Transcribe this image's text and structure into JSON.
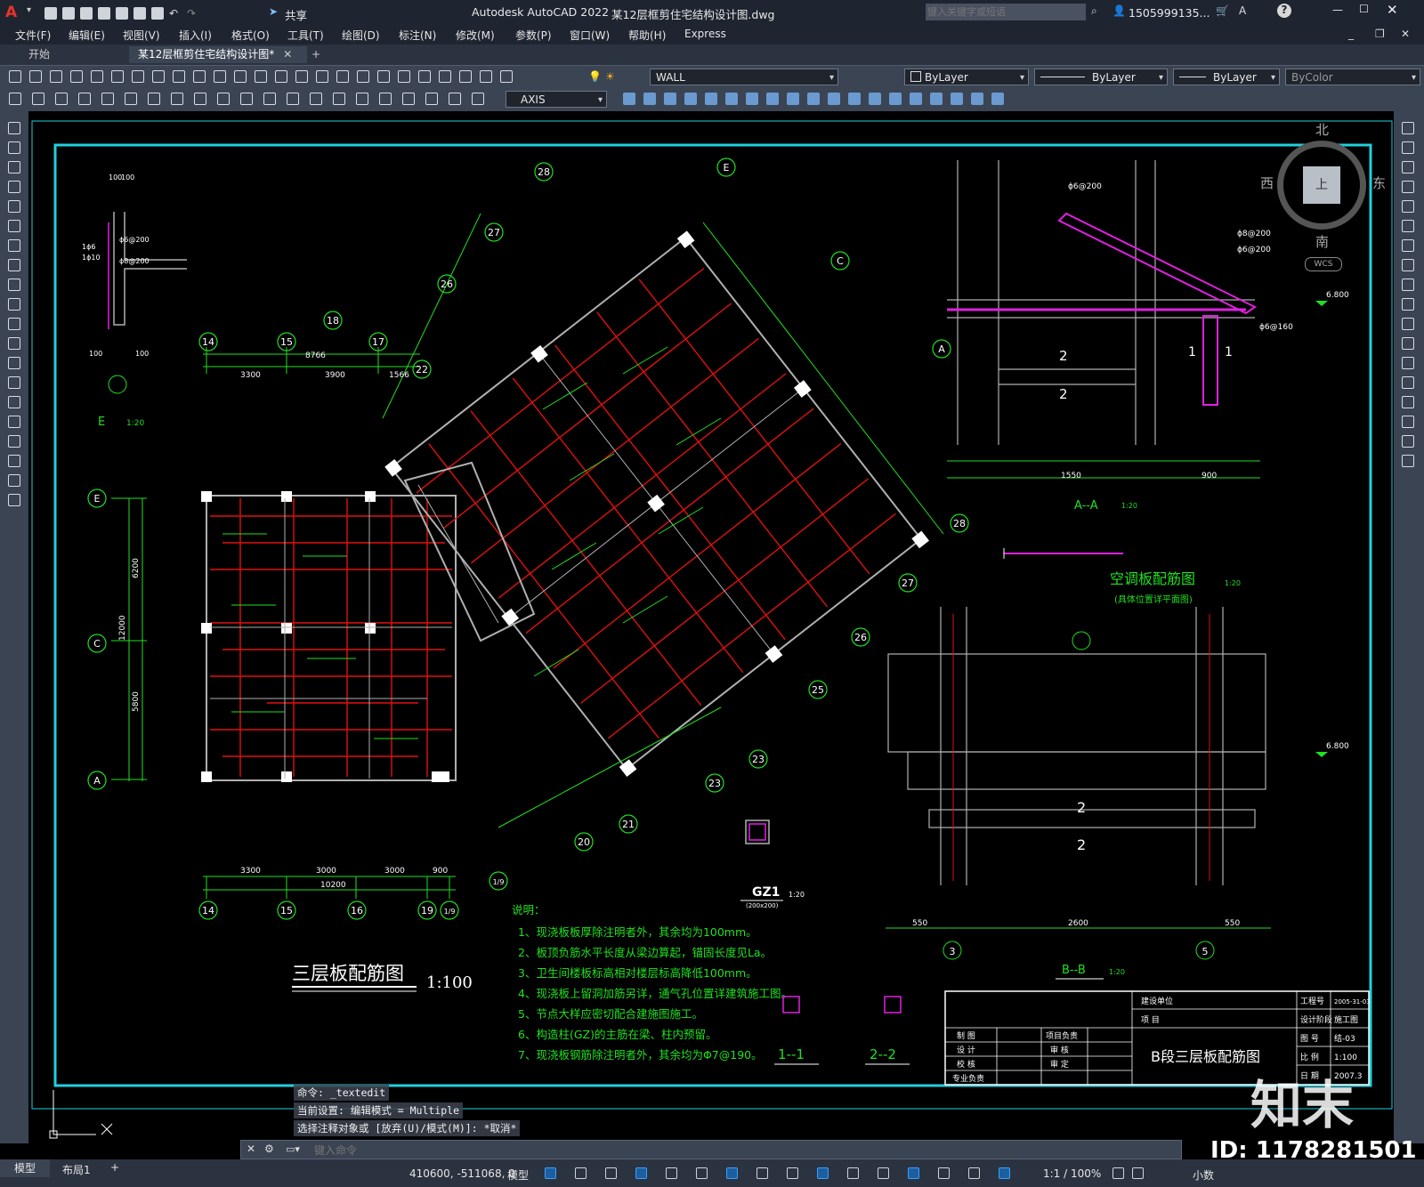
{
  "window": {
    "app_title": "Autodesk AutoCAD 2022",
    "file_title": "某12层框剪住宅结构设计图.dwg",
    "share_label": "共享",
    "search_placeholder": "键入关键字或短语",
    "user": "1505999135...",
    "help_icon": "?"
  },
  "menu": [
    "文件(F)",
    "编辑(E)",
    "视图(V)",
    "插入(I)",
    "格式(O)",
    "工具(T)",
    "绘图(D)",
    "标注(N)",
    "修改(M)",
    "参数(P)",
    "窗口(W)",
    "帮助(H)",
    "Express"
  ],
  "tabs": {
    "start": "开始",
    "active": "某12层框剪住宅结构设计图*",
    "add": "+"
  },
  "toolbar": {
    "layer": "WALL",
    "color": "ByLayer",
    "linetype": "ByLayer",
    "lineweight": "ByLayer",
    "plotstyle": "ByColor",
    "dimstyle": "AXIS"
  },
  "viewcube": {
    "north": "北",
    "south": "南",
    "east": "东",
    "west": "西",
    "top": "上",
    "wcs": "WCS"
  },
  "drawing": {
    "plan_title": "三层板配筋图",
    "plan_scale": "1:100",
    "notes_title": "说明：",
    "notes": [
      "1、现浇板板厚除注明者外，其余均为100mm。",
      "2、板顶负筋水平长度从梁边算起，锚固长度见La。",
      "3、卫生间楼板标高相对楼层标高降低100mm。",
      "4、现浇板上留洞加筋另详，通气孔位置详建筑施工图。",
      "5、节点大样应密切配合建施图施工。",
      "6、构造柱(GZ)的主筋在梁、柱内预留。",
      "7、现浇板钢筋除注明者外，其余均为Φ7@190。"
    ],
    "ac_title": "空调板配筋图",
    "ac_scale": "1:20",
    "ac_sub": "(具体位置详平面图)",
    "aa_title": "A--A",
    "aa_scale": "1:20",
    "bb_title": "B--B",
    "bb_scale": "1:20",
    "gz_title": "GZ1",
    "gz_scale": "1:20",
    "gz_sub": "(200x200)",
    "sec11": "1--1",
    "sec22": "2--2",
    "detail1_scale": "1:20",
    "elev_label": "6.800",
    "axes_bottom": [
      "14",
      "15",
      "16",
      "19",
      "1/9"
    ],
    "axes_top": [
      "14",
      "15",
      "17",
      "18",
      "22"
    ],
    "axes_left": [
      "E",
      "C",
      "A"
    ],
    "axes_rot": [
      "20",
      "21",
      "23",
      "25",
      "26",
      "27",
      "28",
      "E",
      "C",
      "A"
    ],
    "dims_bottom": [
      "3300",
      "3000",
      "3000",
      "900",
      "10200"
    ],
    "dims_top": [
      "3300",
      "3900",
      "1566",
      "8766"
    ],
    "dims_left": [
      "6200",
      "12000",
      "5800"
    ],
    "bb_dims": [
      "550",
      "2600",
      "550"
    ],
    "aa_dims": [
      "1550",
      "900"
    ],
    "axis_bb": [
      "3",
      "5"
    ],
    "title_block": {
      "company": "建设单位",
      "project": "项 目",
      "drawing_name": "B段三层板配筋图",
      "col_labels": [
        "制 图",
        "设 计",
        "校 核",
        "专业负责"
      ],
      "col_labels2": [
        "项目负责",
        "审 核",
        "审 定"
      ],
      "right_labels": [
        "工程号",
        "设计阶段",
        "图 号",
        "比 例",
        "日 期"
      ],
      "right_values": [
        "2005-31-03",
        "施工图",
        "结-03",
        "1:100",
        "2007.3"
      ]
    }
  },
  "command": {
    "history": [
      "命令: _textedit",
      "当前设置: 编辑模式 = Multiple",
      "选择注释对象或 [放弃(U)/模式(M)]: *取消*"
    ],
    "placeholder": "键入命令"
  },
  "layouts": {
    "model": "模型",
    "layout1": "布局1",
    "add": "+"
  },
  "status": {
    "coords": "410600, -511068, 0",
    "space": "模型",
    "scale": "1:1 / 100%",
    "units": "小数"
  },
  "watermark": {
    "brand": "知末",
    "id": "ID: 1178281501"
  }
}
